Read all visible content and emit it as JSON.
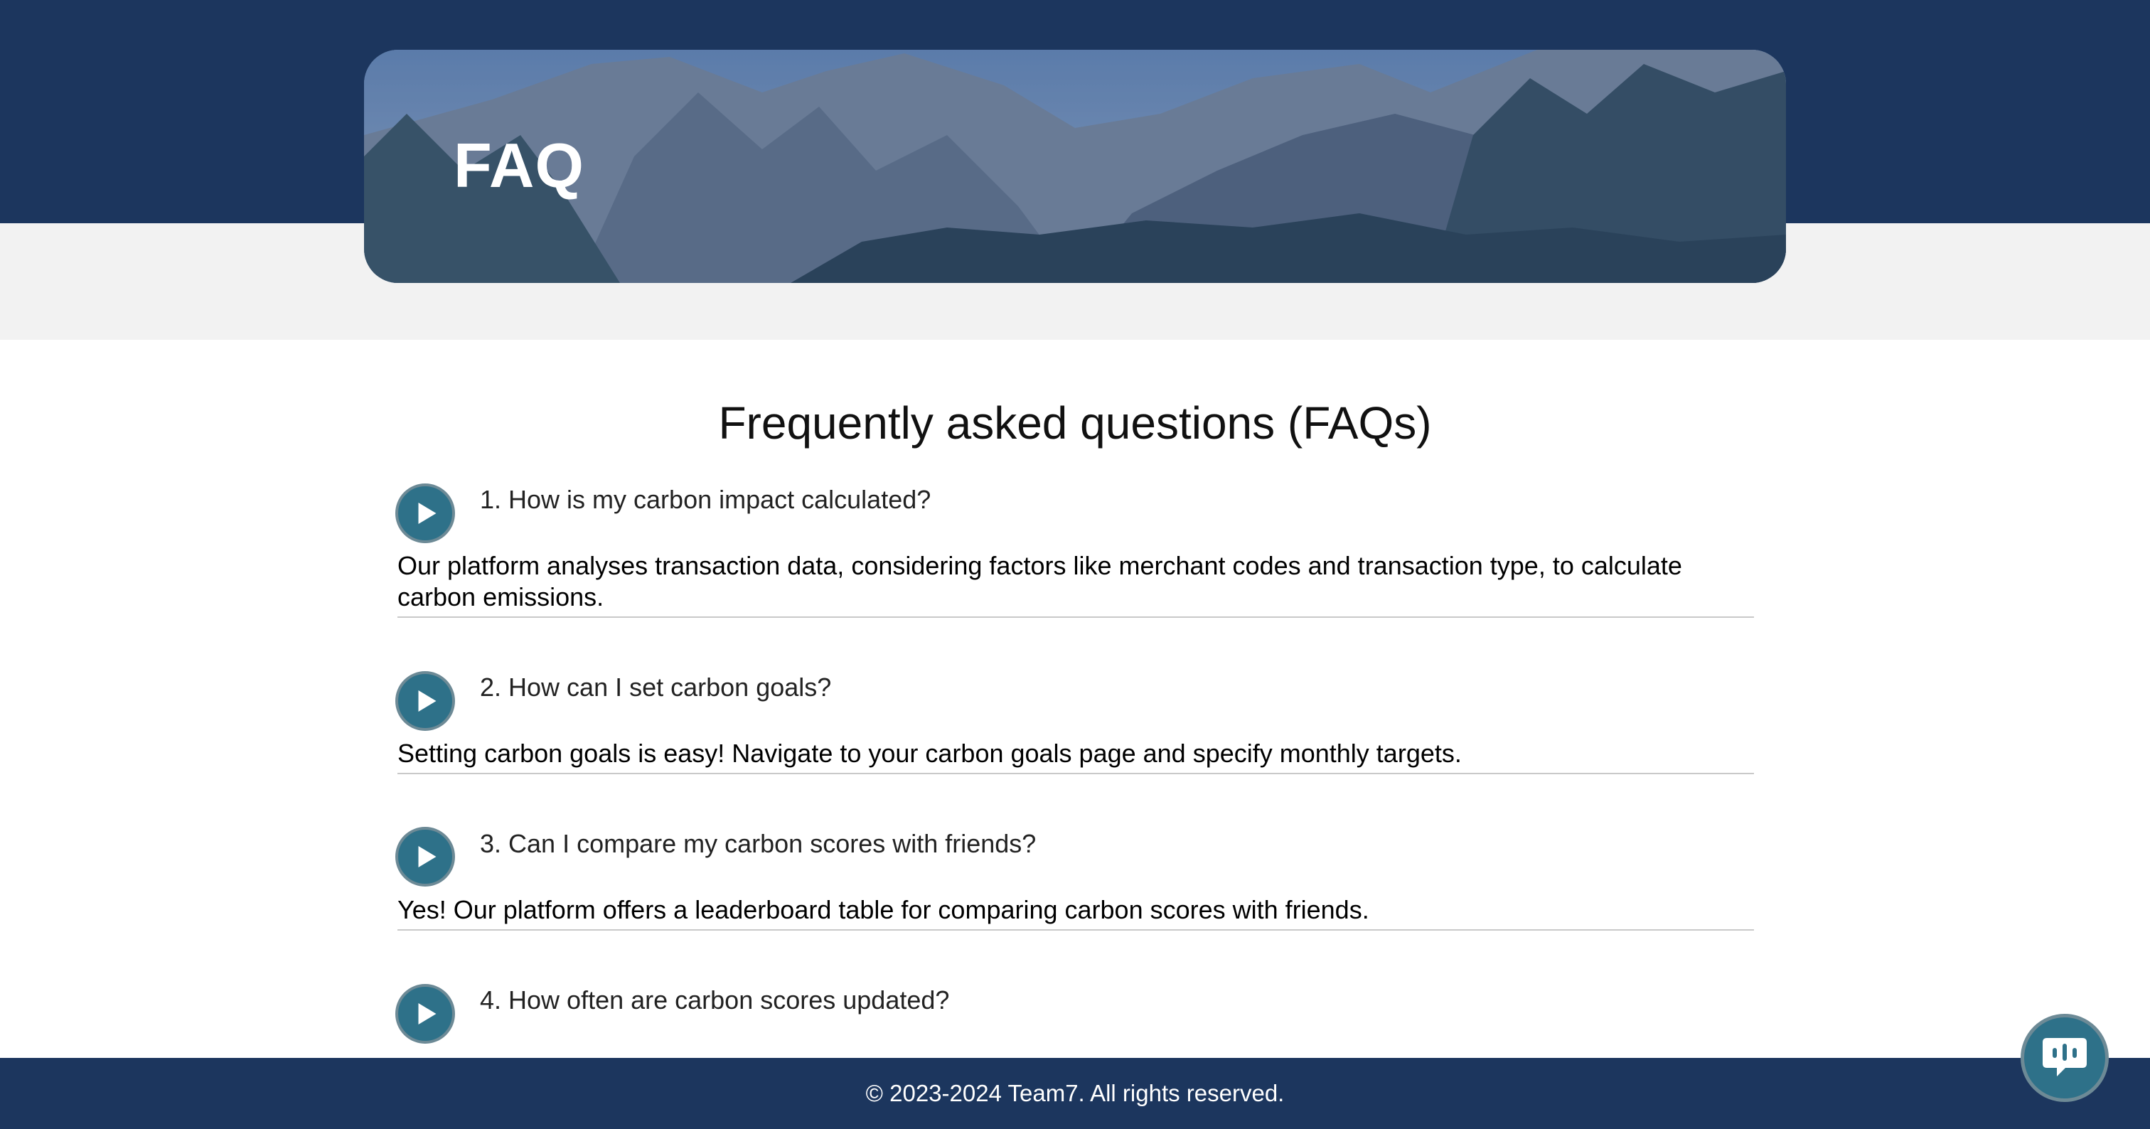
{
  "hero": {
    "title": "FAQ"
  },
  "faq": {
    "heading": "Frequently asked questions (FAQs)",
    "items": [
      {
        "question": "1. How is my carbon impact calculated?",
        "answer": "Our platform analyses transaction data, considering factors like merchant codes and transaction type, to calculate carbon emissions."
      },
      {
        "question": "2. How can I set carbon goals?",
        "answer": "Setting carbon goals is easy! Navigate to your carbon goals page and specify monthly targets."
      },
      {
        "question": "3. Can I compare my carbon scores with friends?",
        "answer": "Yes! Our platform offers a leaderboard table for comparing carbon scores with friends."
      },
      {
        "question": "4. How often are carbon scores updated?",
        "answer": ""
      }
    ]
  },
  "footer": {
    "text": "© 2023-2024 Team7. All rights reserved."
  },
  "icons": {
    "play": "play-icon",
    "chat": "chat-icon"
  },
  "colors": {
    "navy": "#1c365e",
    "teal": "#2e7189",
    "band_grey": "#f2f2f2"
  }
}
